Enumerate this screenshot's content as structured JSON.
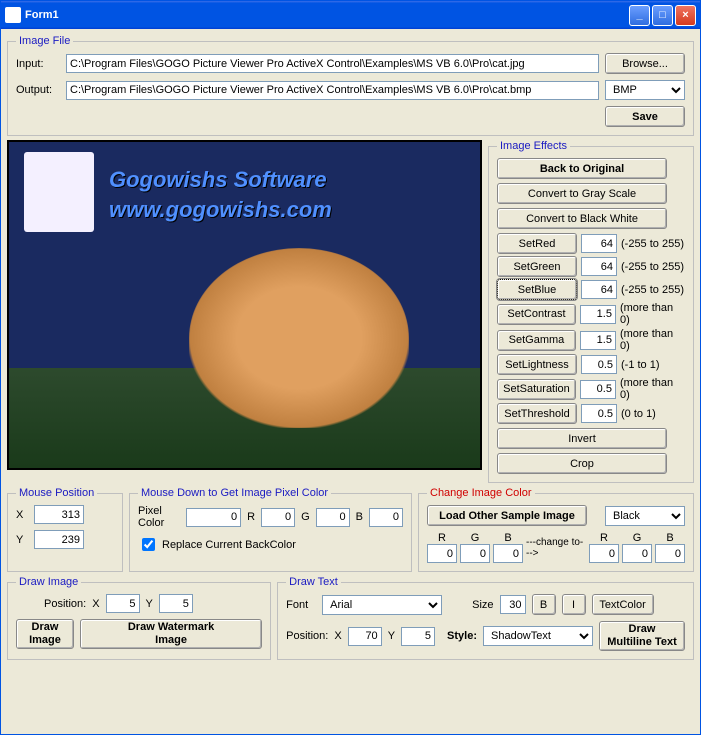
{
  "window": {
    "title": "Form1"
  },
  "imageFile": {
    "legend": "Image File",
    "inputLabel": "Input:",
    "inputPath": "C:\\Program Files\\GOGO Picture Viewer Pro ActiveX Control\\Examples\\MS VB 6.0\\Pro\\cat.jpg",
    "outputLabel": "Output:",
    "outputPath": "C:\\Program Files\\GOGO Picture Viewer Pro ActiveX Control\\Examples\\MS VB 6.0\\Pro\\cat.bmp",
    "browse": "Browse...",
    "format": "BMP",
    "save": "Save"
  },
  "preview": {
    "watermark1": "Gogowishs Software",
    "watermark2": "www.gogowishs.com"
  },
  "effects": {
    "legend": "Image Effects",
    "backOriginal": "Back to Original",
    "gray": "Convert to Gray Scale",
    "bw": "Convert to Black White",
    "rows": [
      {
        "btn": "SetRed",
        "val": "64",
        "hint": "(-255 to 255)"
      },
      {
        "btn": "SetGreen",
        "val": "64",
        "hint": "(-255 to 255)"
      },
      {
        "btn": "SetBlue",
        "val": "64",
        "hint": "(-255 to 255)",
        "focused": true
      },
      {
        "btn": "SetContrast",
        "val": "1.5",
        "hint": "(more than 0)"
      },
      {
        "btn": "SetGamma",
        "val": "1.5",
        "hint": "(more than 0)"
      },
      {
        "btn": "SetLightness",
        "val": "0.5",
        "hint": "(-1 to 1)"
      },
      {
        "btn": "SetSaturation",
        "val": "0.5",
        "hint": "(more than 0)"
      },
      {
        "btn": "SetThreshold",
        "val": "0.5",
        "hint": "(0 to 1)"
      }
    ],
    "invert": "Invert",
    "crop": "Crop"
  },
  "mousePos": {
    "legend": "Mouse Position",
    "xLbl": "X",
    "x": "313",
    "yLbl": "Y",
    "y": "239"
  },
  "mouseDown": {
    "legend": "Mouse Down to Get Image Pixel Color",
    "pixelColorLbl": "Pixel Color",
    "pixelColor": "0",
    "r": "0",
    "g": "0",
    "b": "0",
    "replaceLbl": "Replace Current BackColor"
  },
  "changeColor": {
    "legend": "Change Image Color",
    "loadSample": "Load Other Sample Image",
    "colorSel": "Black",
    "from": {
      "r": "0",
      "g": "0",
      "b": "0"
    },
    "arrow": "---change to--->",
    "to": {
      "r": "0",
      "g": "0",
      "b": "0"
    }
  },
  "drawImage": {
    "legend": "Draw Image",
    "posLbl": "Position:",
    "xLbl": "X",
    "x": "5",
    "yLbl": "Y",
    "y": "5",
    "drawBtn": "Draw\nImage",
    "watermarkBtn": "Draw Watermark\nImage"
  },
  "drawText": {
    "legend": "Draw Text",
    "fontLbl": "Font",
    "font": "Arial",
    "sizeLbl": "Size",
    "size": "30",
    "bBtn": "B",
    "iBtn": "I",
    "textColorBtn": "TextColor",
    "posLbl": "Position:",
    "xLbl": "X",
    "x": "70",
    "yLbl": "Y",
    "y": "5",
    "styleLbl": "Style:",
    "style": "ShadowText",
    "drawBtn": "Draw\nMultiline Text"
  },
  "labels": {
    "R": "R",
    "G": "G",
    "B": "B"
  }
}
